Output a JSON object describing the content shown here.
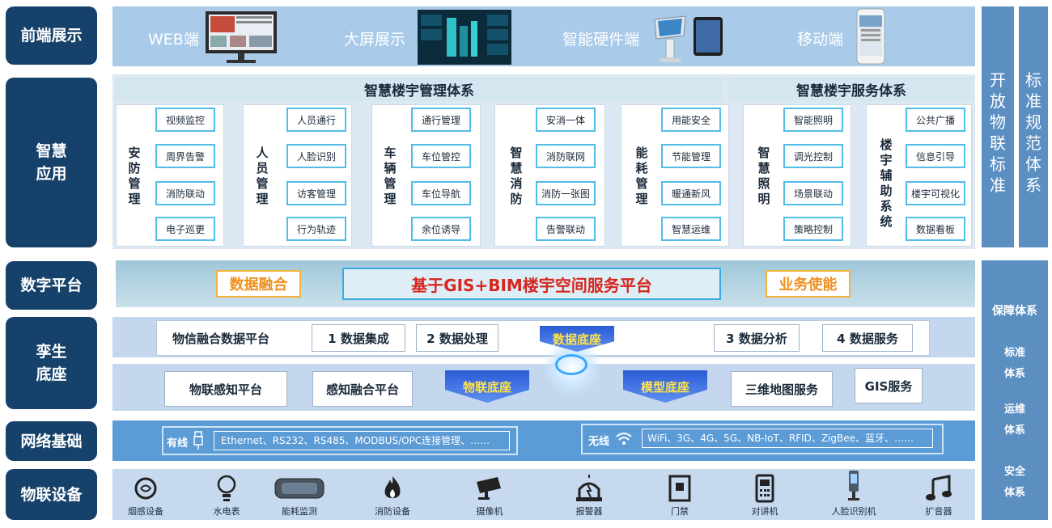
{
  "left_labels": {
    "frontend": "前端展示",
    "smart_app": "智慧\n应用",
    "digital": "数字平台",
    "twin": "孪生\n底座",
    "network": "网络基础",
    "iot": "物联设备"
  },
  "frontend": [
    "WEB端",
    "大屏展示",
    "智能硬件端",
    "移动端"
  ],
  "headers": {
    "management": "智慧楼宇管理体系",
    "service": "智慧楼宇服务体系"
  },
  "modules": [
    {
      "title": "安\n防\n管\n理",
      "items": [
        "视频监控",
        "周界告警",
        "消防联动",
        "电子巡更"
      ]
    },
    {
      "title": "人\n员\n管\n理",
      "items": [
        "人员通行",
        "人脸识别",
        "访客管理",
        "行为轨迹"
      ]
    },
    {
      "title": "车\n辆\n管\n理",
      "items": [
        "通行管理",
        "车位管控",
        "车位导航",
        "余位诱导"
      ]
    },
    {
      "title": "智\n慧\n消\n防",
      "items": [
        "安消一体",
        "消防联网",
        "消防一张图",
        "告警联动"
      ]
    },
    {
      "title": "能\n耗\n管\n理",
      "items": [
        "用能安全",
        "节能管理",
        "暖通新风",
        "智慧运维"
      ]
    },
    {
      "title": "智\n慧\n照\n明",
      "items": [
        "智能照明",
        "调光控制",
        "场景联动",
        "策略控制"
      ]
    },
    {
      "title": "楼\n宇\n辅\n助\n系\n统",
      "items": [
        "公共广播",
        "信息引导",
        "楼宇可视化",
        "数据看板"
      ]
    }
  ],
  "digital_platform": {
    "left": "数据融合",
    "center": "基于GIS+BIM楼宇空间服务平台",
    "right": "业务使能"
  },
  "twin": {
    "row1": [
      "物信融合数据平台",
      "1 数据集成",
      "2 数据处理",
      "3 数据分析",
      "4 数据服务"
    ],
    "data_base": "数据底座",
    "row2": [
      "物联感知平台",
      "感知融合平台",
      "三维地图服务",
      "GIS服务"
    ],
    "iot_base": "物联底座",
    "model_base": "模型底座"
  },
  "network": {
    "wired_label": "有线",
    "wired": "Ethernet、RS232、RS485、MODBUS/OPC连接管理、……",
    "wireless_label": "无线",
    "wireless": "WiFi、3G、4G、5G、NB-IoT、RFID、ZigBee、蓝牙、……"
  },
  "devices": [
    "烟感设备",
    "水电表",
    "能耗监测",
    "消防设备",
    "摄像机",
    "报警器",
    "门禁",
    "对讲机",
    "人脸识别机",
    "扩音器"
  ],
  "right": {
    "open": "开\n放\n物\n联\n标\n准",
    "standard": "标\n准\n规\n范\n体\n系",
    "guarantee": "保障体系",
    "std_sys": "标准\n体系",
    "ops_sys": "运维\n体系",
    "sec_sys": "安全\n体系"
  }
}
